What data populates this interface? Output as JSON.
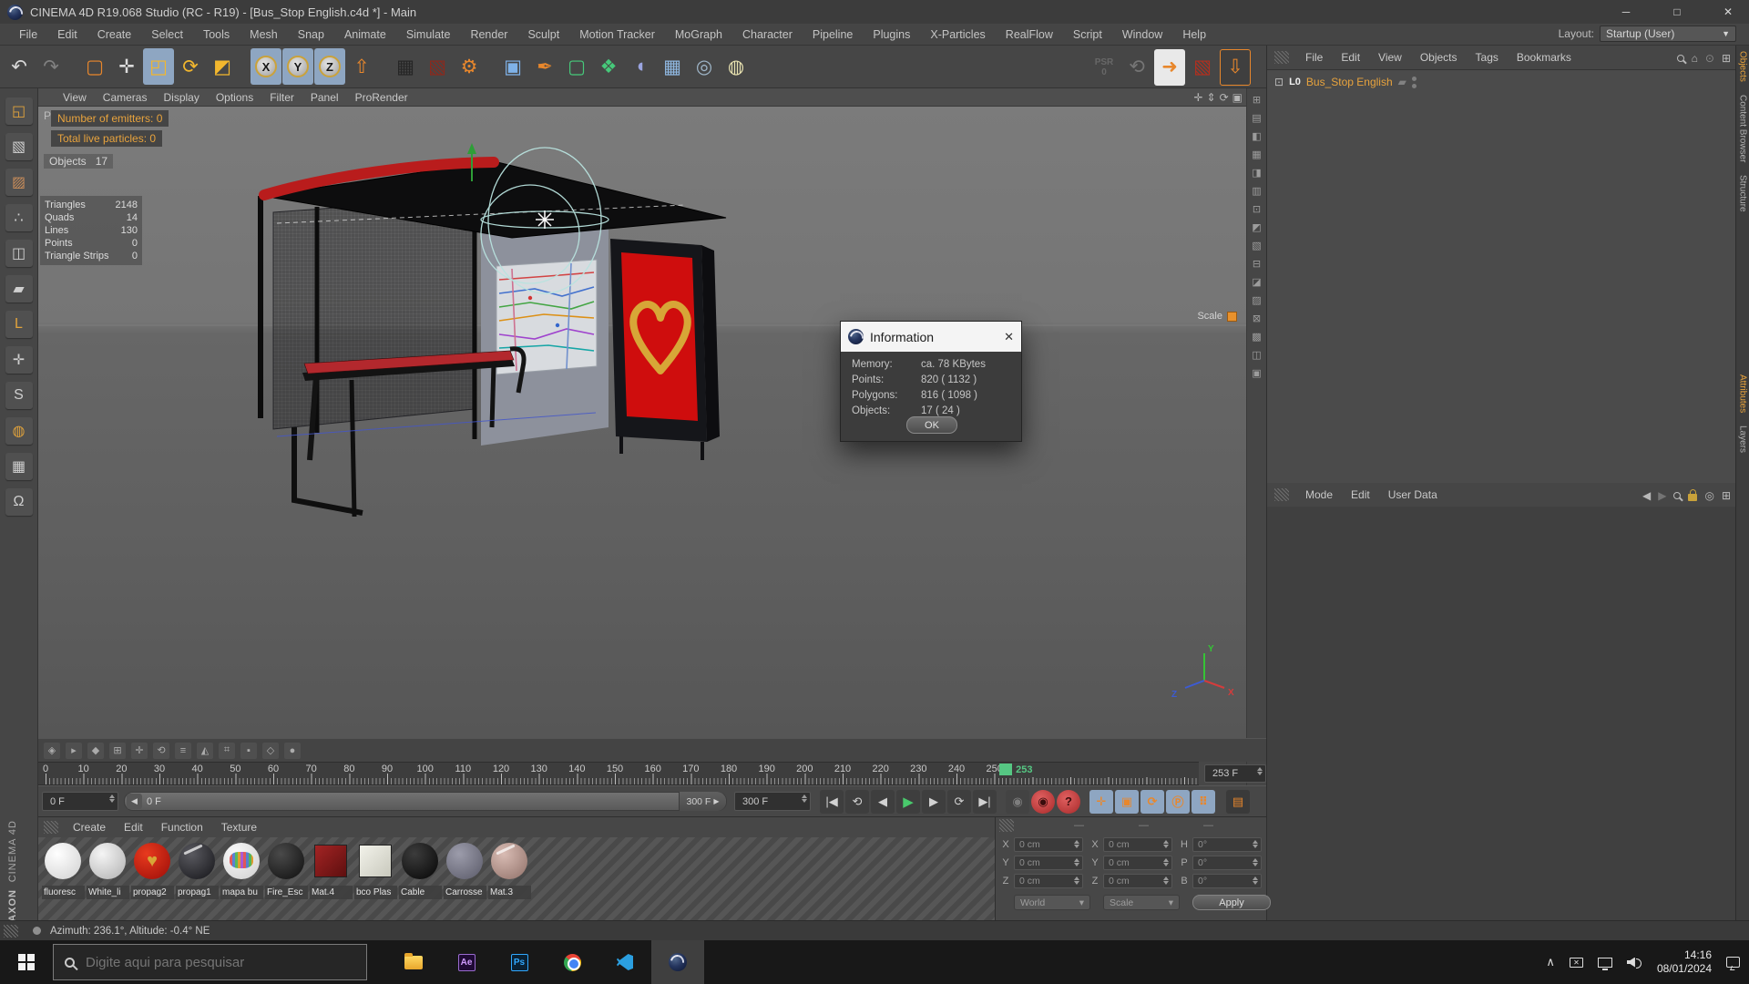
{
  "window": {
    "title": "CINEMA 4D R19.068 Studio (RC - R19) - [Bus_Stop English.c4d *] - Main",
    "minimize": "─",
    "maximize": "□",
    "close": "✕"
  },
  "menu_bar": {
    "items": [
      "File",
      "Edit",
      "Create",
      "Select",
      "Tools",
      "Mesh",
      "Snap",
      "Animate",
      "Simulate",
      "Render",
      "Sculpt",
      "Motion Tracker",
      "MoGraph",
      "Character",
      "Pipeline",
      "Plugins",
      "X-Particles",
      "RealFlow",
      "Script",
      "Window",
      "Help"
    ]
  },
  "layout": {
    "label": "Layout:",
    "value": "Startup (User)"
  },
  "toolbar": {
    "psr_label": "PSR",
    "psr_value": "0",
    "groups": [
      [
        {
          "n": "undo-icon",
          "g": "↶",
          "c": "#d8d8d8"
        },
        {
          "n": "redo-icon",
          "g": "↷",
          "c": "#d8d8d8",
          "dim": true
        }
      ],
      [
        {
          "n": "live-selection-icon",
          "g": "▢",
          "c": "#e8872c"
        },
        {
          "n": "move-tool-icon",
          "g": "✛",
          "c": "#dcdcdc"
        },
        {
          "n": "scale-tool-icon",
          "g": "◰",
          "c": "#f2b72e",
          "active": true
        },
        {
          "n": "rotate-tool-icon",
          "g": "⟳",
          "c": "#f2b72e"
        },
        {
          "n": "last-tool-icon",
          "g": "◩",
          "c": "#f2b72e"
        }
      ],
      [
        {
          "n": "lock-x-axis-icon",
          "g": "X",
          "axis": true,
          "active": true
        },
        {
          "n": "lock-y-axis-icon",
          "g": "Y",
          "axis": true,
          "active": true
        },
        {
          "n": "lock-z-axis-icon",
          "g": "Z",
          "axis": true,
          "active": true
        },
        {
          "n": "coordinate-system-icon",
          "g": "⇧",
          "c": "#e8872c"
        }
      ],
      [
        {
          "n": "render-view-icon",
          "g": "▦",
          "c": "#262626"
        },
        {
          "n": "render-region-icon",
          "g": "▧",
          "c": "#8a2a1e"
        },
        {
          "n": "render-settings-icon",
          "g": "⚙",
          "c": "#e8872c"
        }
      ],
      [
        {
          "n": "primitive-cube-icon",
          "g": "▣",
          "c": "#7fb2e8"
        },
        {
          "n": "spline-pen-icon",
          "g": "✒",
          "c": "#e8872c"
        },
        {
          "n": "subdivision-surface-icon",
          "g": "▢",
          "c": "#46c97a"
        },
        {
          "n": "deformer-icon",
          "g": "❖",
          "c": "#46c97a"
        },
        {
          "n": "simulate-icon",
          "g": "◖",
          "c": "#9aa4e0"
        },
        {
          "n": "floor-icon",
          "g": "▦",
          "c": "#8fb7e0"
        },
        {
          "n": "camera-icon",
          "g": "◎",
          "c": "#9fb6c9"
        },
        {
          "n": "light-icon",
          "g": "◍",
          "c": "#e8e2b0"
        }
      ]
    ],
    "right_icons": [
      {
        "n": "refresh-psr-icon",
        "g": "⟲",
        "c": "#bdbdbd",
        "dim": true
      },
      {
        "n": "keyframe-path-icon",
        "g": "➜",
        "c": "#e8872c",
        "lite": true
      },
      {
        "n": "render-clapper-icon",
        "g": "▧",
        "c": "#b03020"
      },
      {
        "n": "mesh-deform-icon",
        "g": "⇩",
        "c": "#e8872c",
        "obord": true
      }
    ]
  },
  "left_palette": [
    {
      "n": "make-editable-icon",
      "g": "◱",
      "c": "#e0a23c"
    },
    {
      "n": "model-mode-icon",
      "g": "▧",
      "c": "#cfcfcf"
    },
    {
      "n": "texture-mode-icon",
      "g": "▨",
      "c": "#c98d5a"
    },
    {
      "n": "point-mode-icon",
      "g": "∴",
      "c": "#cfcfcf"
    },
    {
      "n": "edge-mode-icon",
      "g": "◫",
      "c": "#cfcfcf"
    },
    {
      "n": "polygon-mode-icon",
      "g": "▰",
      "c": "#cfcfcf"
    },
    {
      "n": "workplane-mode-icon",
      "g": "L",
      "c": "#e0a23c"
    },
    {
      "n": "axis-mode-icon",
      "g": "✛",
      "c": "#cfcfcf"
    },
    {
      "n": "snap-mode-icon",
      "g": "S",
      "c": "#cfcfcf"
    },
    {
      "n": "paint-mode-icon",
      "g": "◍",
      "c": "#e0a23c"
    },
    {
      "n": "array-mode-icon",
      "g": "▦",
      "c": "#cfcfcf"
    },
    {
      "n": "magnet-mode-icon",
      "g": "Ω",
      "c": "#cfcfcf"
    }
  ],
  "viewport": {
    "menu": [
      "View",
      "Cameras",
      "Display",
      "Options",
      "Filter",
      "Panel",
      "ProRender"
    ],
    "corner_icons": [
      {
        "n": "pan-view-icon",
        "g": "✛"
      },
      {
        "n": "zoom-view-icon",
        "g": "⇕"
      },
      {
        "n": "rotate-view-icon",
        "g": "⟳"
      },
      {
        "n": "toggle-view-icon",
        "g": "▣"
      }
    ],
    "hud": {
      "camera_partial": "P",
      "emitters": "Number of emitters: 0",
      "particles": "Total live particles: 0",
      "objects_label": "Objects",
      "objects_value": "17",
      "stats": [
        {
          "label": "Triangles",
          "value": "2148"
        },
        {
          "label": "Quads",
          "value": "14"
        },
        {
          "label": "Lines",
          "value": "130"
        },
        {
          "label": "Points",
          "value": "0"
        },
        {
          "label": "Triangle Strips",
          "value": "0"
        }
      ],
      "tool_label": "Scale"
    },
    "axis": {
      "x": "X",
      "y": "Y",
      "z": "Z"
    }
  },
  "info_dialog": {
    "title": "Information",
    "rows": [
      {
        "label": "Memory:",
        "value": "ca. 78 KBytes"
      },
      {
        "label": "Points:",
        "value": "820 ( 1132 )"
      },
      {
        "label": "Polygons:",
        "value": "816 ( 1098 )"
      },
      {
        "label": "Objects:",
        "value": "17 ( 24 )"
      }
    ],
    "ok_label": "OK",
    "close": "✕"
  },
  "object_manager": {
    "menu": [
      "File",
      "Edit",
      "View",
      "Objects",
      "Tags",
      "Bookmarks"
    ],
    "object_name": "Bus_Stop English",
    "object_icon": "L0"
  },
  "attribute_manager": {
    "menu": [
      "Mode",
      "Edit",
      "User Data"
    ]
  },
  "side_tabs": {
    "top": [
      "Objects",
      "Content Browser",
      "Structure"
    ],
    "bottom": [
      "Attributes",
      "Layers"
    ]
  },
  "timeline": {
    "start": 0,
    "end": 300,
    "label_step": 10,
    "current": 253,
    "frame_box": "253 F"
  },
  "transport": {
    "start_value": "0 F",
    "slider_start": "0 F",
    "slider_end": "300 F",
    "end_value": "300 F",
    "buttons": [
      {
        "n": "goto-start-button",
        "g": "|◀"
      },
      {
        "n": "prev-key-button",
        "g": "⟲"
      },
      {
        "n": "prev-frame-button",
        "g": "◀"
      },
      {
        "n": "play-button",
        "g": "▶",
        "play": true
      },
      {
        "n": "next-frame-button",
        "g": "▶"
      },
      {
        "n": "next-key-button",
        "g": "⟳"
      },
      {
        "n": "goto-end-button",
        "g": "▶|"
      }
    ],
    "record_buttons": [
      {
        "n": "record-button",
        "g": "◉",
        "dim": true
      },
      {
        "n": "autokey-button",
        "g": "◉",
        "red": true
      },
      {
        "n": "keyframe-help-button",
        "g": "?",
        "red": true
      }
    ],
    "key_toggles": [
      {
        "n": "key-position-toggle",
        "g": "✛"
      },
      {
        "n": "key-scale-toggle",
        "g": "▣"
      },
      {
        "n": "key-rotation-toggle",
        "g": "⟳"
      },
      {
        "n": "key-parameter-toggle",
        "g": "Ⓟ"
      },
      {
        "n": "key-pla-toggle",
        "g": "⠿"
      }
    ],
    "film_icon": "▤"
  },
  "mini_icons": [
    {
      "n": "key-diamond-icon",
      "g": "◈"
    },
    {
      "n": "key-play-icon",
      "g": "▸"
    },
    {
      "n": "key-solid-icon",
      "g": "◆"
    },
    {
      "n": "key-grid-icon",
      "g": "⊞"
    },
    {
      "n": "key-move-icon",
      "g": "✛"
    },
    {
      "n": "key-loop-icon",
      "g": "⟲"
    },
    {
      "n": "key-list-icon",
      "g": "≡"
    },
    {
      "n": "key-tri-icon",
      "g": "◭"
    },
    {
      "n": "key-hash-icon",
      "g": "⌗"
    },
    {
      "n": "key-square-icon",
      "g": "▪"
    },
    {
      "n": "key-outline-icon",
      "g": "◇"
    },
    {
      "n": "key-record-icon",
      "g": "●"
    }
  ],
  "strip_icons": [
    {
      "n": "vs-1",
      "g": "⊞"
    },
    {
      "n": "vs-2",
      "g": "▤"
    },
    {
      "n": "vs-3",
      "g": "◧"
    },
    {
      "n": "vs-4",
      "g": "▦"
    },
    {
      "n": "vs-5",
      "g": "◨"
    },
    {
      "n": "vs-6",
      "g": "▥"
    },
    {
      "n": "vs-7",
      "g": "⊡"
    },
    {
      "n": "vs-8",
      "g": "◩"
    },
    {
      "n": "vs-9",
      "g": "▧"
    },
    {
      "n": "vs-10",
      "g": "⊟"
    },
    {
      "n": "vs-11",
      "g": "◪"
    },
    {
      "n": "vs-12",
      "g": "▨"
    },
    {
      "n": "vs-13",
      "g": "⊠"
    },
    {
      "n": "vs-14",
      "g": "▩"
    },
    {
      "n": "vs-15",
      "g": "◫"
    },
    {
      "n": "vs-16",
      "g": "▣"
    }
  ],
  "material_manager": {
    "menu": [
      "Create",
      "Edit",
      "Function",
      "Texture"
    ],
    "materials": [
      {
        "name": "fluoresc",
        "shape": "sphere",
        "c1": "#ffffff",
        "c2": "#d0d0d0"
      },
      {
        "name": "White_li",
        "shape": "sphere",
        "c1": "#f5f5f5",
        "c2": "#b0b0b0"
      },
      {
        "name": "propag2",
        "shape": "sphere",
        "c1": "#e83a1e",
        "c2": "#9c0d08",
        "overlay": "heart"
      },
      {
        "name": "propag1",
        "shape": "sphere",
        "c1": "#5a5a60",
        "c2": "#141418",
        "overlay": "streak"
      },
      {
        "name": "mapa bu",
        "shape": "sphere",
        "c1": "#fafafa",
        "c2": "#cfcfcf",
        "overlay": "map"
      },
      {
        "name": "Fire_Esc",
        "shape": "sphere",
        "c1": "#4a4a4a",
        "c2": "#0e0e0e"
      },
      {
        "name": "Mat.4",
        "shape": "cube",
        "c1": "#a32424",
        "c2": "#5e0f0f"
      },
      {
        "name": "bco Plas",
        "shape": "cube",
        "c1": "#f2f2ea",
        "c2": "#c9c9bd"
      },
      {
        "name": "Cable",
        "shape": "sphere",
        "c1": "#3c3c3c",
        "c2": "#050505"
      },
      {
        "name": "Carrosse",
        "shape": "sphere",
        "c1": "#9c9cab",
        "c2": "#5a5a68"
      },
      {
        "name": "Mat.3",
        "shape": "sphere",
        "c1": "#d9bcb4",
        "c2": "#8f7068",
        "overlay": "streak"
      }
    ]
  },
  "coordinates": {
    "dash": "—",
    "cols": [
      {
        "labels": [
          "X",
          "Y",
          "Z"
        ],
        "value": "0 cm",
        "footer": "World",
        "footer_type": "dropdown"
      },
      {
        "labels": [
          "X",
          "Y",
          "Z"
        ],
        "value": "0 cm",
        "footer": "Scale",
        "footer_type": "dropdown"
      },
      {
        "labels": [
          "H",
          "P",
          "B"
        ],
        "value": "0°",
        "footer": "Apply",
        "footer_type": "button"
      }
    ]
  },
  "branding": {
    "maxon": "MAXON",
    "cinema": "CINEMA 4D"
  },
  "status_bar": {
    "text": "Azimuth: 236.1°, Altitude: -0.4°  NE"
  },
  "taskbar": {
    "search_placeholder": "Digite aqui para pesquisar",
    "apps": [
      {
        "name": "file-explorer"
      },
      {
        "name": "after-effects",
        "label": "Ae"
      },
      {
        "name": "photoshop",
        "label": "Ps"
      },
      {
        "name": "chrome"
      },
      {
        "name": "vscode"
      },
      {
        "name": "cinema4d",
        "active": true
      }
    ],
    "clock_time": "14:16",
    "clock_date": "08/01/2024"
  }
}
